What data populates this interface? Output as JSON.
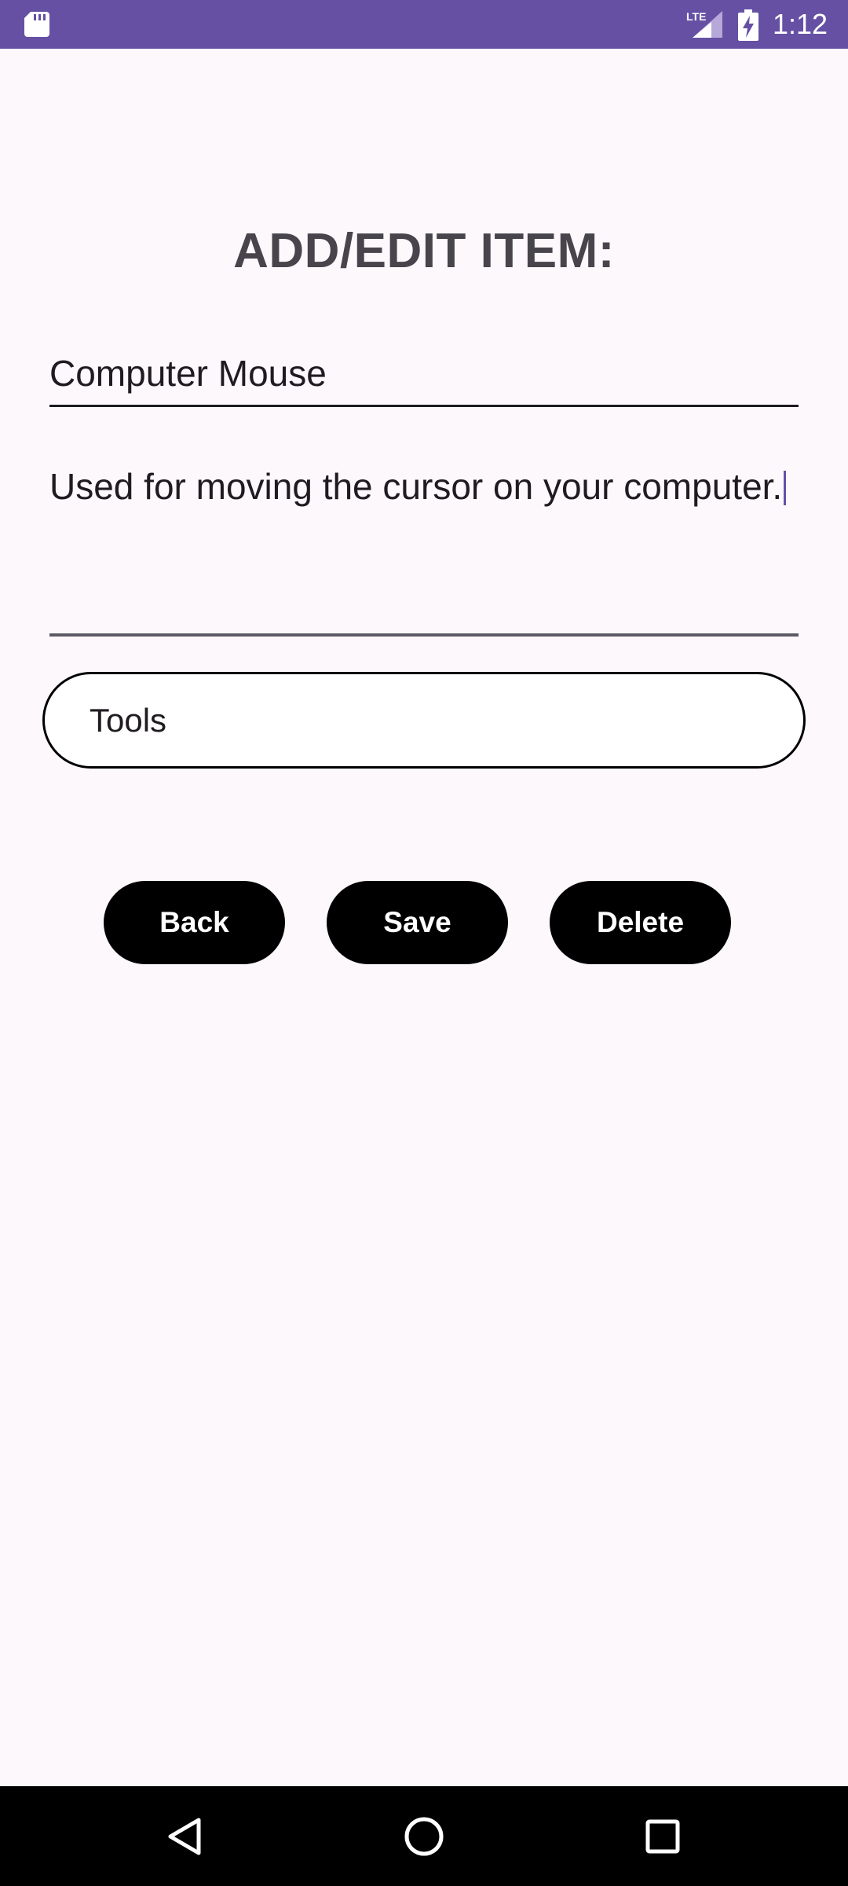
{
  "status_bar": {
    "time": "1:12",
    "network": "LTE",
    "background_color": "#6650a4",
    "icons": [
      "sd-card-icon",
      "lte-signal-icon",
      "battery-charging-icon"
    ]
  },
  "title": "ADD/EDIT ITEM:",
  "form": {
    "name_value": "Computer Mouse",
    "description_value": "Used for moving the cursor on your computer.",
    "category_value": "Tools"
  },
  "buttons": {
    "back": "Back",
    "save": "Save",
    "delete": "Delete"
  },
  "nav_bar": {
    "icons": [
      "nav-back-icon",
      "nav-home-icon",
      "nav-recents-icon"
    ]
  },
  "colors": {
    "accent": "#6650a4",
    "background": "#fdf8fc",
    "button_background": "#000000",
    "button_text": "#ffffff",
    "title_text": "#47444c"
  }
}
